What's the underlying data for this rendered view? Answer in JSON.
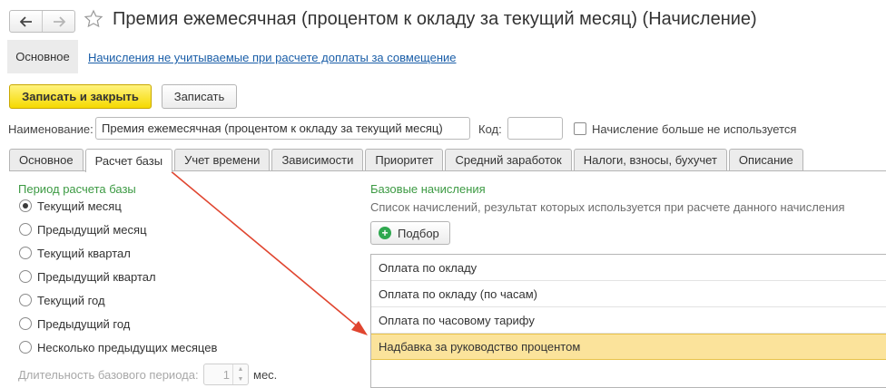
{
  "window": {
    "title": "Премия ежемесячная (процентом к окладу за текущий месяц) (Начисление)"
  },
  "sections": {
    "main": "Основное",
    "link": "Начисления не учитываемые при расчете доплаты за совмещение"
  },
  "commands": {
    "save_close": "Записать и закрыть",
    "save": "Записать"
  },
  "form": {
    "name_label": "Наименование:",
    "name_value": "Премия ежемесячная (процентом к окладу за текущий месяц)",
    "code_label": "Код:",
    "code_value": "",
    "unused_label": "Начисление больше не используется"
  },
  "tabs": [
    {
      "label": "Основное"
    },
    {
      "label": "Расчет базы"
    },
    {
      "label": "Учет времени"
    },
    {
      "label": "Зависимости"
    },
    {
      "label": "Приоритет"
    },
    {
      "label": "Средний заработок"
    },
    {
      "label": "Налоги, взносы, бухучет"
    },
    {
      "label": "Описание"
    }
  ],
  "base_period": {
    "title": "Период расчета базы",
    "options": [
      {
        "label": "Текущий месяц",
        "checked": true
      },
      {
        "label": "Предыдущий месяц",
        "checked": false
      },
      {
        "label": "Текущий квартал",
        "checked": false
      },
      {
        "label": "Предыдущий квартал",
        "checked": false
      },
      {
        "label": "Текущий год",
        "checked": false
      },
      {
        "label": "Предыдущий год",
        "checked": false
      },
      {
        "label": "Несколько предыдущих месяцев",
        "checked": false
      }
    ],
    "duration_label": "Длительность базового периода:",
    "duration_value": "1",
    "duration_unit": "мес."
  },
  "base_accruals": {
    "title": "Базовые начисления",
    "description": "Список начислений, результат которых используется при расчете данного начисления",
    "pick_button": "Подбор",
    "items": [
      {
        "label": "Оплата по окладу"
      },
      {
        "label": "Оплата по окладу (по часам)"
      },
      {
        "label": "Оплата по часовому тарифу"
      },
      {
        "label": "Надбавка за руководство процентом"
      }
    ]
  },
  "colors": {
    "accent_yellow": "#f5d900",
    "group_title_green": "#3c9a43",
    "link_blue": "#1a5ea8",
    "selected_row": "#fbe39b",
    "annotation_arrow": "#e0452f"
  }
}
